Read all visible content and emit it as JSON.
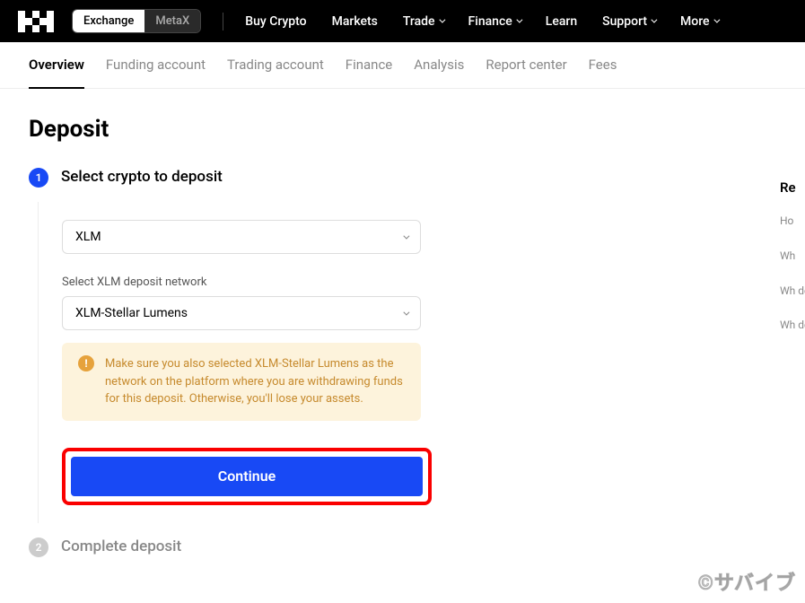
{
  "topnav": {
    "toggle": {
      "exchange": "Exchange",
      "metax": "MetaX"
    },
    "items": [
      {
        "label": "Buy Crypto",
        "dropdown": false
      },
      {
        "label": "Markets",
        "dropdown": false
      },
      {
        "label": "Trade",
        "dropdown": true
      },
      {
        "label": "Finance",
        "dropdown": true
      },
      {
        "label": "Learn",
        "dropdown": false
      },
      {
        "label": "Support",
        "dropdown": true
      },
      {
        "label": "More",
        "dropdown": true
      }
    ]
  },
  "subnav": {
    "items": [
      "Overview",
      "Funding account",
      "Trading account",
      "Finance",
      "Analysis",
      "Report center",
      "Fees"
    ],
    "active": 0
  },
  "page": {
    "title": "Deposit"
  },
  "step1": {
    "num": "1",
    "title": "Select crypto to deposit",
    "crypto_select": "XLM",
    "network_label": "Select XLM deposit network",
    "network_select": "XLM-Stellar Lumens",
    "warning": "Make sure you also selected XLM-Stellar Lumens as the network on the platform where you are withdrawing funds for this deposit. Otherwise, you'll lose your assets.",
    "continue_btn": "Continue"
  },
  "step2": {
    "num": "2",
    "title": "Complete deposit"
  },
  "sidebar": {
    "title": "Re",
    "links": [
      "Ho",
      "Wh",
      "Wh\ndep",
      "Wh\ndep"
    ]
  },
  "watermark": "©サバイブ"
}
